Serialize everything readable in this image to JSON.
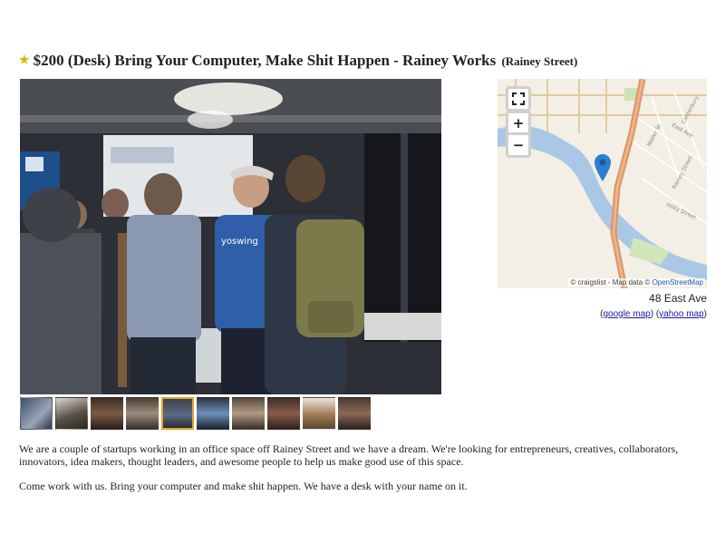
{
  "posting": {
    "title": "$200 (Desk) Bring Your Computer, Make Shit Happen - Rainey Works",
    "location": "(Rainey Street)"
  },
  "gallery": {
    "thumbnail_count": 10,
    "selected_index": 4
  },
  "map": {
    "fullscreen_icon": "fullscreen-icon",
    "zoom_in_label": "+",
    "zoom_out_label": "−",
    "attribution": "© craigslist - Map data ©",
    "attribution_link": "OpenStreetMap",
    "street_labels": [
      "Waller St",
      "Rainey Street",
      "East Ave",
      "Holly Street",
      "Canterbury"
    ]
  },
  "location_block": {
    "address": "48 East Ave",
    "open_paren": "(",
    "google_map": "google map",
    "separator": ") (",
    "yahoo_map": "yahoo map",
    "close_paren": ")"
  },
  "description": {
    "paragraph1": "We are a couple of startups working in an office space off Rainey Street and we have a dream. We're looking for entrepreneurs, creatives, collaborators, innovators, idea makers, thought leaders, and awesome people to help us make good use of this space.",
    "paragraph2": "Come work with us. Bring your computer and make shit happen. We have a desk with your name on it."
  },
  "colors": {
    "star": "#d9b800",
    "selected_thumb_border": "#e6a42a",
    "link": "#1a1aa6",
    "map_pin": "#2b7fd0",
    "highway": "#d9956a"
  }
}
